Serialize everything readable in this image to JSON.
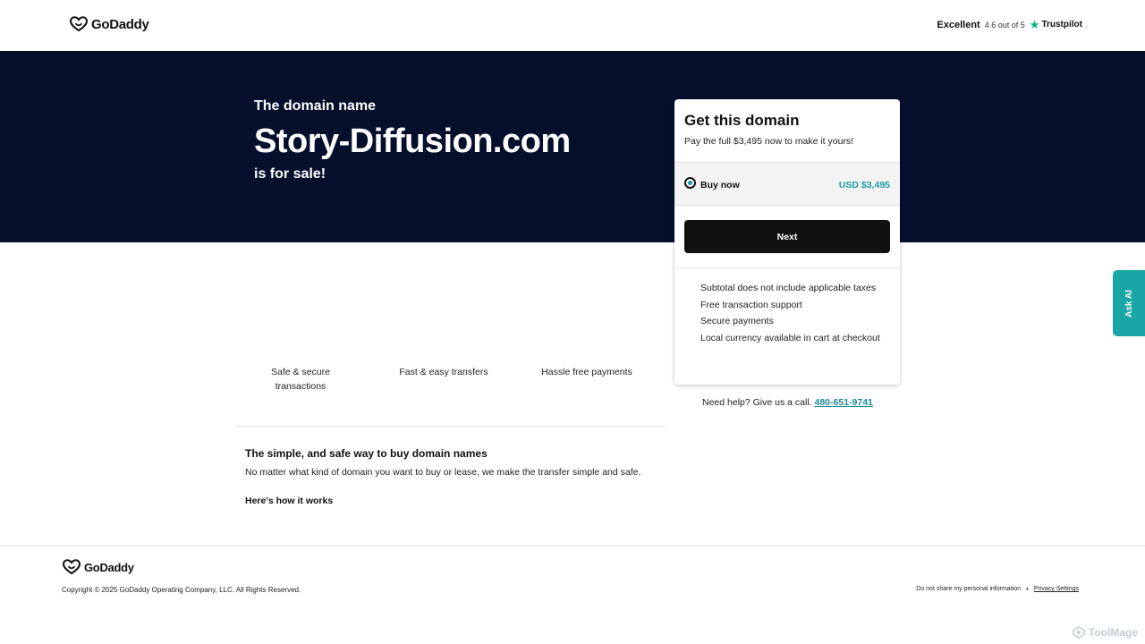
{
  "header": {
    "logo_text": "GoDaddy",
    "trustpilot": {
      "label": "Excellent",
      "rating": "4.6 out of 5",
      "brand": "Trustpilot"
    }
  },
  "hero": {
    "pre_title": "The domain name",
    "domain": "Story-Diffusion.com",
    "post_title": "is for sale!"
  },
  "card": {
    "title": "Get this domain",
    "subtitle": "Pay the full $3,495 now to make it yours!",
    "option": {
      "label": "Buy now",
      "price": "USD $3,495",
      "selected": true
    },
    "next_label": "Next",
    "benefits": [
      "Subtotal does not include applicable taxes",
      "Free transaction support",
      "Secure payments",
      "Local currency available in cart at checkout"
    ]
  },
  "help": {
    "text": "Need help? Give us a call.",
    "phone": "480-651-9741"
  },
  "features": [
    "Safe & secure transactions",
    "Fast & easy transfers",
    "Hassle free payments"
  ],
  "info": {
    "title": "The simple, and safe way to buy domain names",
    "body": "No matter what kind of domain you want to buy or lease, we make the transfer simple and safe.",
    "link": "Here's how it works"
  },
  "ask_ai": "Ask AI",
  "footer": {
    "logo_text": "GoDaddy",
    "copyright": "Copyright © 2025 GoDaddy Operating Company, LLC. All Rights Reserved.",
    "do_not_share": "Do not share my personal information",
    "separator": "•",
    "privacy": "Privacy Settings"
  },
  "watermark": "ToolMage",
  "colors": {
    "hero_bg": "#040f2c",
    "accent_teal": "#1a9ca6",
    "button_bg": "#111111",
    "trustpilot_green": "#00b67a"
  }
}
